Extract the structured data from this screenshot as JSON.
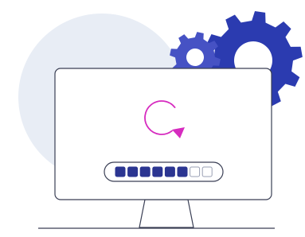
{
  "illustration": {
    "subject": "computer-updating",
    "icons": {
      "monitor": "monitor-icon",
      "refresh": "refresh-icon",
      "gear_large": "gear-icon",
      "gear_small": "gear-icon"
    },
    "progress": {
      "filled_segments": 6,
      "total_segments": 8,
      "fraction": 0.75
    },
    "colors": {
      "background_circle": "#e8edf5",
      "gear_large": "#2b3bb0",
      "gear_small": "#4652c4",
      "gear_hole": "#ffffff",
      "monitor_outline": "#3a3f55",
      "monitor_screen": "#ffffff",
      "segment_filled": "#2b3591",
      "segment_empty": "#ffffff",
      "refresh_accent": "#d62bbf"
    }
  }
}
